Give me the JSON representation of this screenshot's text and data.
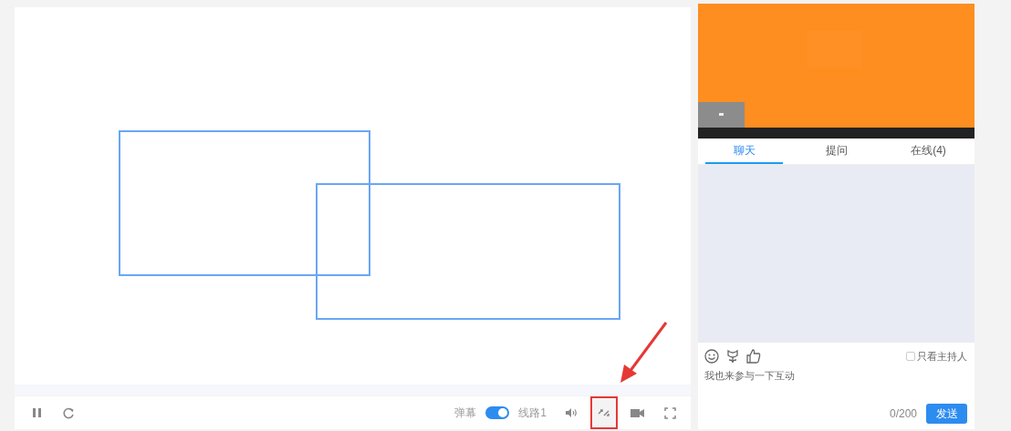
{
  "player": {
    "left_controls": [
      {
        "kind": "pause"
      },
      {
        "kind": "refresh"
      }
    ],
    "danmaku": {
      "label": "弹幕",
      "on": true
    },
    "line": "线路1",
    "right_controls": [
      {
        "kind": "volume",
        "highlighted": false
      },
      {
        "kind": "switch",
        "highlighted": true
      },
      {
        "kind": "camera",
        "highlighted": false
      },
      {
        "kind": "fullscreen",
        "highlighted": false
      }
    ]
  },
  "side": {
    "tabs": [
      {
        "label": "聊天",
        "selected": true
      },
      {
        "label": "提问",
        "selected": false
      },
      {
        "label": "在线(4)",
        "selected": false
      }
    ],
    "tools": [
      {
        "kind": "emoji"
      },
      {
        "kind": "flower"
      },
      {
        "kind": "like"
      }
    ],
    "host_only": {
      "label": "只看主持人",
      "checked": false
    },
    "input": {
      "placeholder": "我也来参与一下互动"
    },
    "counter": "0/200",
    "send": "发送"
  }
}
